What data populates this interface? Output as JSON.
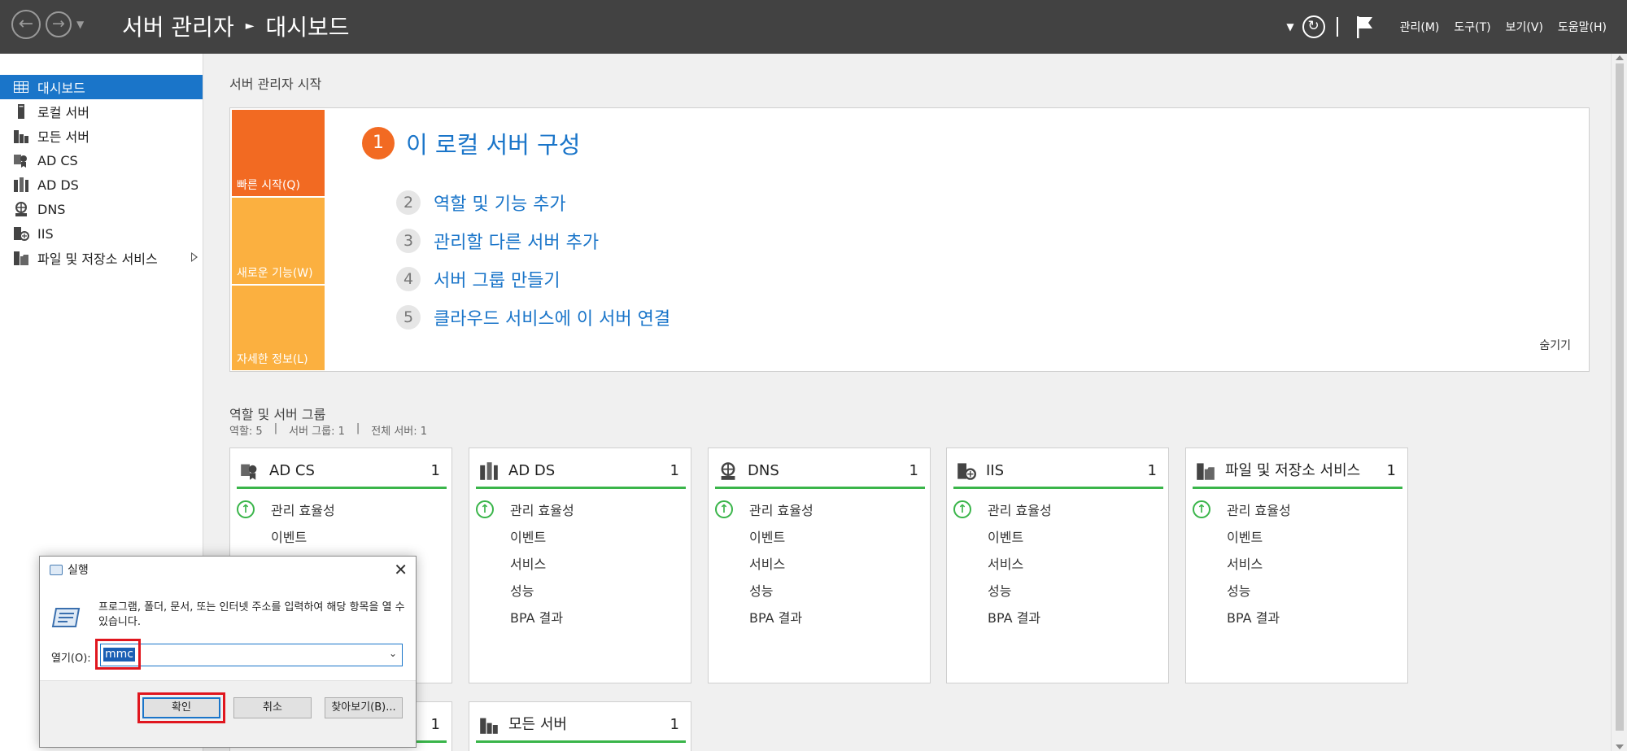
{
  "titlebar": {
    "app_title": "서버 관리자",
    "current_page": "대시보드",
    "menus": [
      "관리(M)",
      "도구(T)",
      "보기(V)",
      "도움말(H)"
    ]
  },
  "sidebar": {
    "items": [
      {
        "label": "대시보드",
        "icon": "dashboard-icon",
        "active": true
      },
      {
        "label": "로컬 서버",
        "icon": "local-server-icon"
      },
      {
        "label": "모든 서버",
        "icon": "all-servers-icon"
      },
      {
        "label": "AD CS",
        "icon": "adcs-icon"
      },
      {
        "label": "AD DS",
        "icon": "adds-icon"
      },
      {
        "label": "DNS",
        "icon": "dns-icon"
      },
      {
        "label": "IIS",
        "icon": "iis-icon"
      },
      {
        "label": "파일 및 저장소 서비스",
        "icon": "file-storage-icon",
        "has_submenu": true
      }
    ]
  },
  "quickstart": {
    "heading": "서버 관리자 시작",
    "tabs": [
      "빠른 시작(Q)",
      "새로운 기능(W)",
      "자세한 정보(L)"
    ],
    "step1": {
      "num": "1",
      "label": "이 로컬 서버 구성"
    },
    "steps": [
      {
        "num": "2",
        "label": "역할 및 기능 추가"
      },
      {
        "num": "3",
        "label": "관리할 다른 서버 추가"
      },
      {
        "num": "4",
        "label": "서버 그룹 만들기"
      },
      {
        "num": "5",
        "label": "클라우드 서비스에 이 서버 연결"
      }
    ],
    "hide_label": "숨기기"
  },
  "roles": {
    "heading": "역할 및 서버 그룹",
    "summary": [
      "역할: 5",
      "|",
      "서버 그룹: 1",
      "|",
      "전체 서버: 1"
    ],
    "row_labels": [
      "관리 효율성",
      "이벤트",
      "서비스",
      "성능",
      "BPA 결과"
    ],
    "cards": [
      {
        "title": "AD CS",
        "count": "1",
        "icon": "adcs-icon"
      },
      {
        "title": "AD DS",
        "count": "1",
        "icon": "adds-icon"
      },
      {
        "title": "DNS",
        "count": "1",
        "icon": "dns-icon"
      },
      {
        "title": "IIS",
        "count": "1",
        "icon": "iis-icon"
      },
      {
        "title": "파일 및 저장소 서비스",
        "count": "1",
        "icon": "file-storage-icon"
      }
    ],
    "bottom_cards": [
      {
        "title": "",
        "count": "1"
      },
      {
        "title": "모든 서버",
        "count": "1"
      }
    ]
  },
  "run_dialog": {
    "title": "실행",
    "description": "프로그램, 폴더, 문서, 또는 인터넷 주소를 입력하여 해당 항목을 열 수 있습니다.",
    "open_label": "열기(O):",
    "open_value": "mmc",
    "ok_label": "확인",
    "cancel_label": "취소",
    "browse_label": "찾아보기(B)..."
  },
  "colors": {
    "titlebar_bg": "#424242",
    "accent_blue": "#1a75c9",
    "quickstart_orange": "#f26a22",
    "quickstart_yellow": "#fbb040",
    "status_green": "#3ab54a",
    "highlight_red": "#e0161e"
  }
}
